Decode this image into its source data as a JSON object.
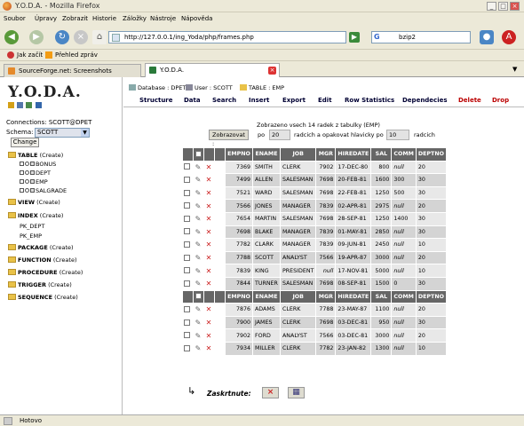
{
  "window": {
    "title": "Y.O.D.A. - Mozilla Firefox"
  },
  "menu": {
    "items": [
      "Soubor",
      "Úpravy",
      "Zobrazit",
      "Historie",
      "Záložky",
      "Nástroje",
      "Nápověda"
    ]
  },
  "nav": {
    "url": "http://127.0.0.1/ing_Yoda/php/frames.php",
    "search_engine": "G",
    "search_value": "bzip2"
  },
  "bookmarks": {
    "items": [
      "Jak začít",
      "Přehled zpráv"
    ]
  },
  "tabs": [
    {
      "label": "SourceForge.net: Screenshots",
      "active": false
    },
    {
      "label": "Y.O.D.A.",
      "active": true
    }
  ],
  "left": {
    "logo": "Y.O.D.A.",
    "connections_label": "Connections: SCOTT@DPET",
    "schema_label": "Schema:",
    "schema_value": "SCOTT",
    "change_button": "Change",
    "tree": [
      {
        "label": "TABLE",
        "create": "(Create)",
        "kind": "folder"
      },
      {
        "label": "BONUS",
        "kind": "sub"
      },
      {
        "label": "DEPT",
        "kind": "sub"
      },
      {
        "label": "EMP",
        "kind": "sub"
      },
      {
        "label": "SALGRADE",
        "kind": "sub"
      },
      {
        "label": "VIEW",
        "create": "(Create)",
        "kind": "folder"
      },
      {
        "label": "INDEX",
        "create": "(Create)",
        "kind": "folder"
      },
      {
        "label": "PK_DEPT",
        "kind": "plain"
      },
      {
        "label": "PK_EMP",
        "kind": "plain"
      },
      {
        "label": "PACKAGE",
        "create": "(Create)",
        "kind": "folder"
      },
      {
        "label": "FUNCTION",
        "create": "(Create)",
        "kind": "folder"
      },
      {
        "label": "PROCEDURE",
        "create": "(Create)",
        "kind": "folder"
      },
      {
        "label": "TRIGGER",
        "create": "(Create)",
        "kind": "folder"
      },
      {
        "label": "SEQUENCE",
        "create": "(Create)",
        "kind": "folder"
      }
    ]
  },
  "top": {
    "database": "Database : DPET",
    "user": "User : SCOTT",
    "table": "TABLE : EMP",
    "nav": [
      "Structure",
      "Data",
      "Search",
      "Insert",
      "Export",
      "Edit",
      "Row Statistics",
      "Dependecies",
      "Delete",
      "Drop"
    ]
  },
  "main": {
    "info": "Zobrazeno vsech 14 radek z tabulky (EMP)",
    "show_button": "Zobrazovat :",
    "po_label": "po",
    "rows_value": "20",
    "repeat_label": "radcich a opakovat hlavicky po",
    "repeat_value": "10",
    "rows_unit": "radcich",
    "columns": [
      "EMPNO",
      "ENAME",
      "JOB",
      "MGR",
      "HIREDATE",
      "SAL",
      "COMM",
      "DEPTNO"
    ],
    "rows_block1": [
      [
        "7369",
        "SMITH",
        "CLERK",
        "7902",
        "17-DEC-80",
        "800",
        "null",
        "20"
      ],
      [
        "7499",
        "ALLEN",
        "SALESMAN",
        "7698",
        "20-FEB-81",
        "1600",
        "300",
        "30"
      ],
      [
        "7521",
        "WARD",
        "SALESMAN",
        "7698",
        "22-FEB-81",
        "1250",
        "500",
        "30"
      ],
      [
        "7566",
        "JONES",
        "MANAGER",
        "7839",
        "02-APR-81",
        "2975",
        "null",
        "20"
      ],
      [
        "7654",
        "MARTIN",
        "SALESMAN",
        "7698",
        "28-SEP-81",
        "1250",
        "1400",
        "30"
      ],
      [
        "7698",
        "BLAKE",
        "MANAGER",
        "7839",
        "01-MAY-81",
        "2850",
        "null",
        "30"
      ],
      [
        "7782",
        "CLARK",
        "MANAGER",
        "7839",
        "09-JUN-81",
        "2450",
        "null",
        "10"
      ],
      [
        "7788",
        "SCOTT",
        "ANALYST",
        "7566",
        "19-APR-87",
        "3000",
        "null",
        "20"
      ],
      [
        "7839",
        "KING",
        "PRESIDENT",
        "null",
        "17-NOV-81",
        "5000",
        "null",
        "10"
      ],
      [
        "7844",
        "TURNER",
        "SALESMAN",
        "7698",
        "08-SEP-81",
        "1500",
        "0",
        "30"
      ]
    ],
    "rows_block2": [
      [
        "7876",
        "ADAMS",
        "CLERK",
        "7788",
        "23-MAY-87",
        "1100",
        "null",
        "20"
      ],
      [
        "7900",
        "JAMES",
        "CLERK",
        "7698",
        "03-DEC-81",
        "950",
        "null",
        "30"
      ],
      [
        "7902",
        "FORD",
        "ANALYST",
        "7566",
        "03-DEC-81",
        "3000",
        "null",
        "20"
      ],
      [
        "7934",
        "MILLER",
        "CLERK",
        "7782",
        "23-JAN-82",
        "1300",
        "null",
        "10"
      ]
    ],
    "checked_label": "Zaskrtnute:"
  },
  "status": {
    "text": "Hotovo"
  }
}
